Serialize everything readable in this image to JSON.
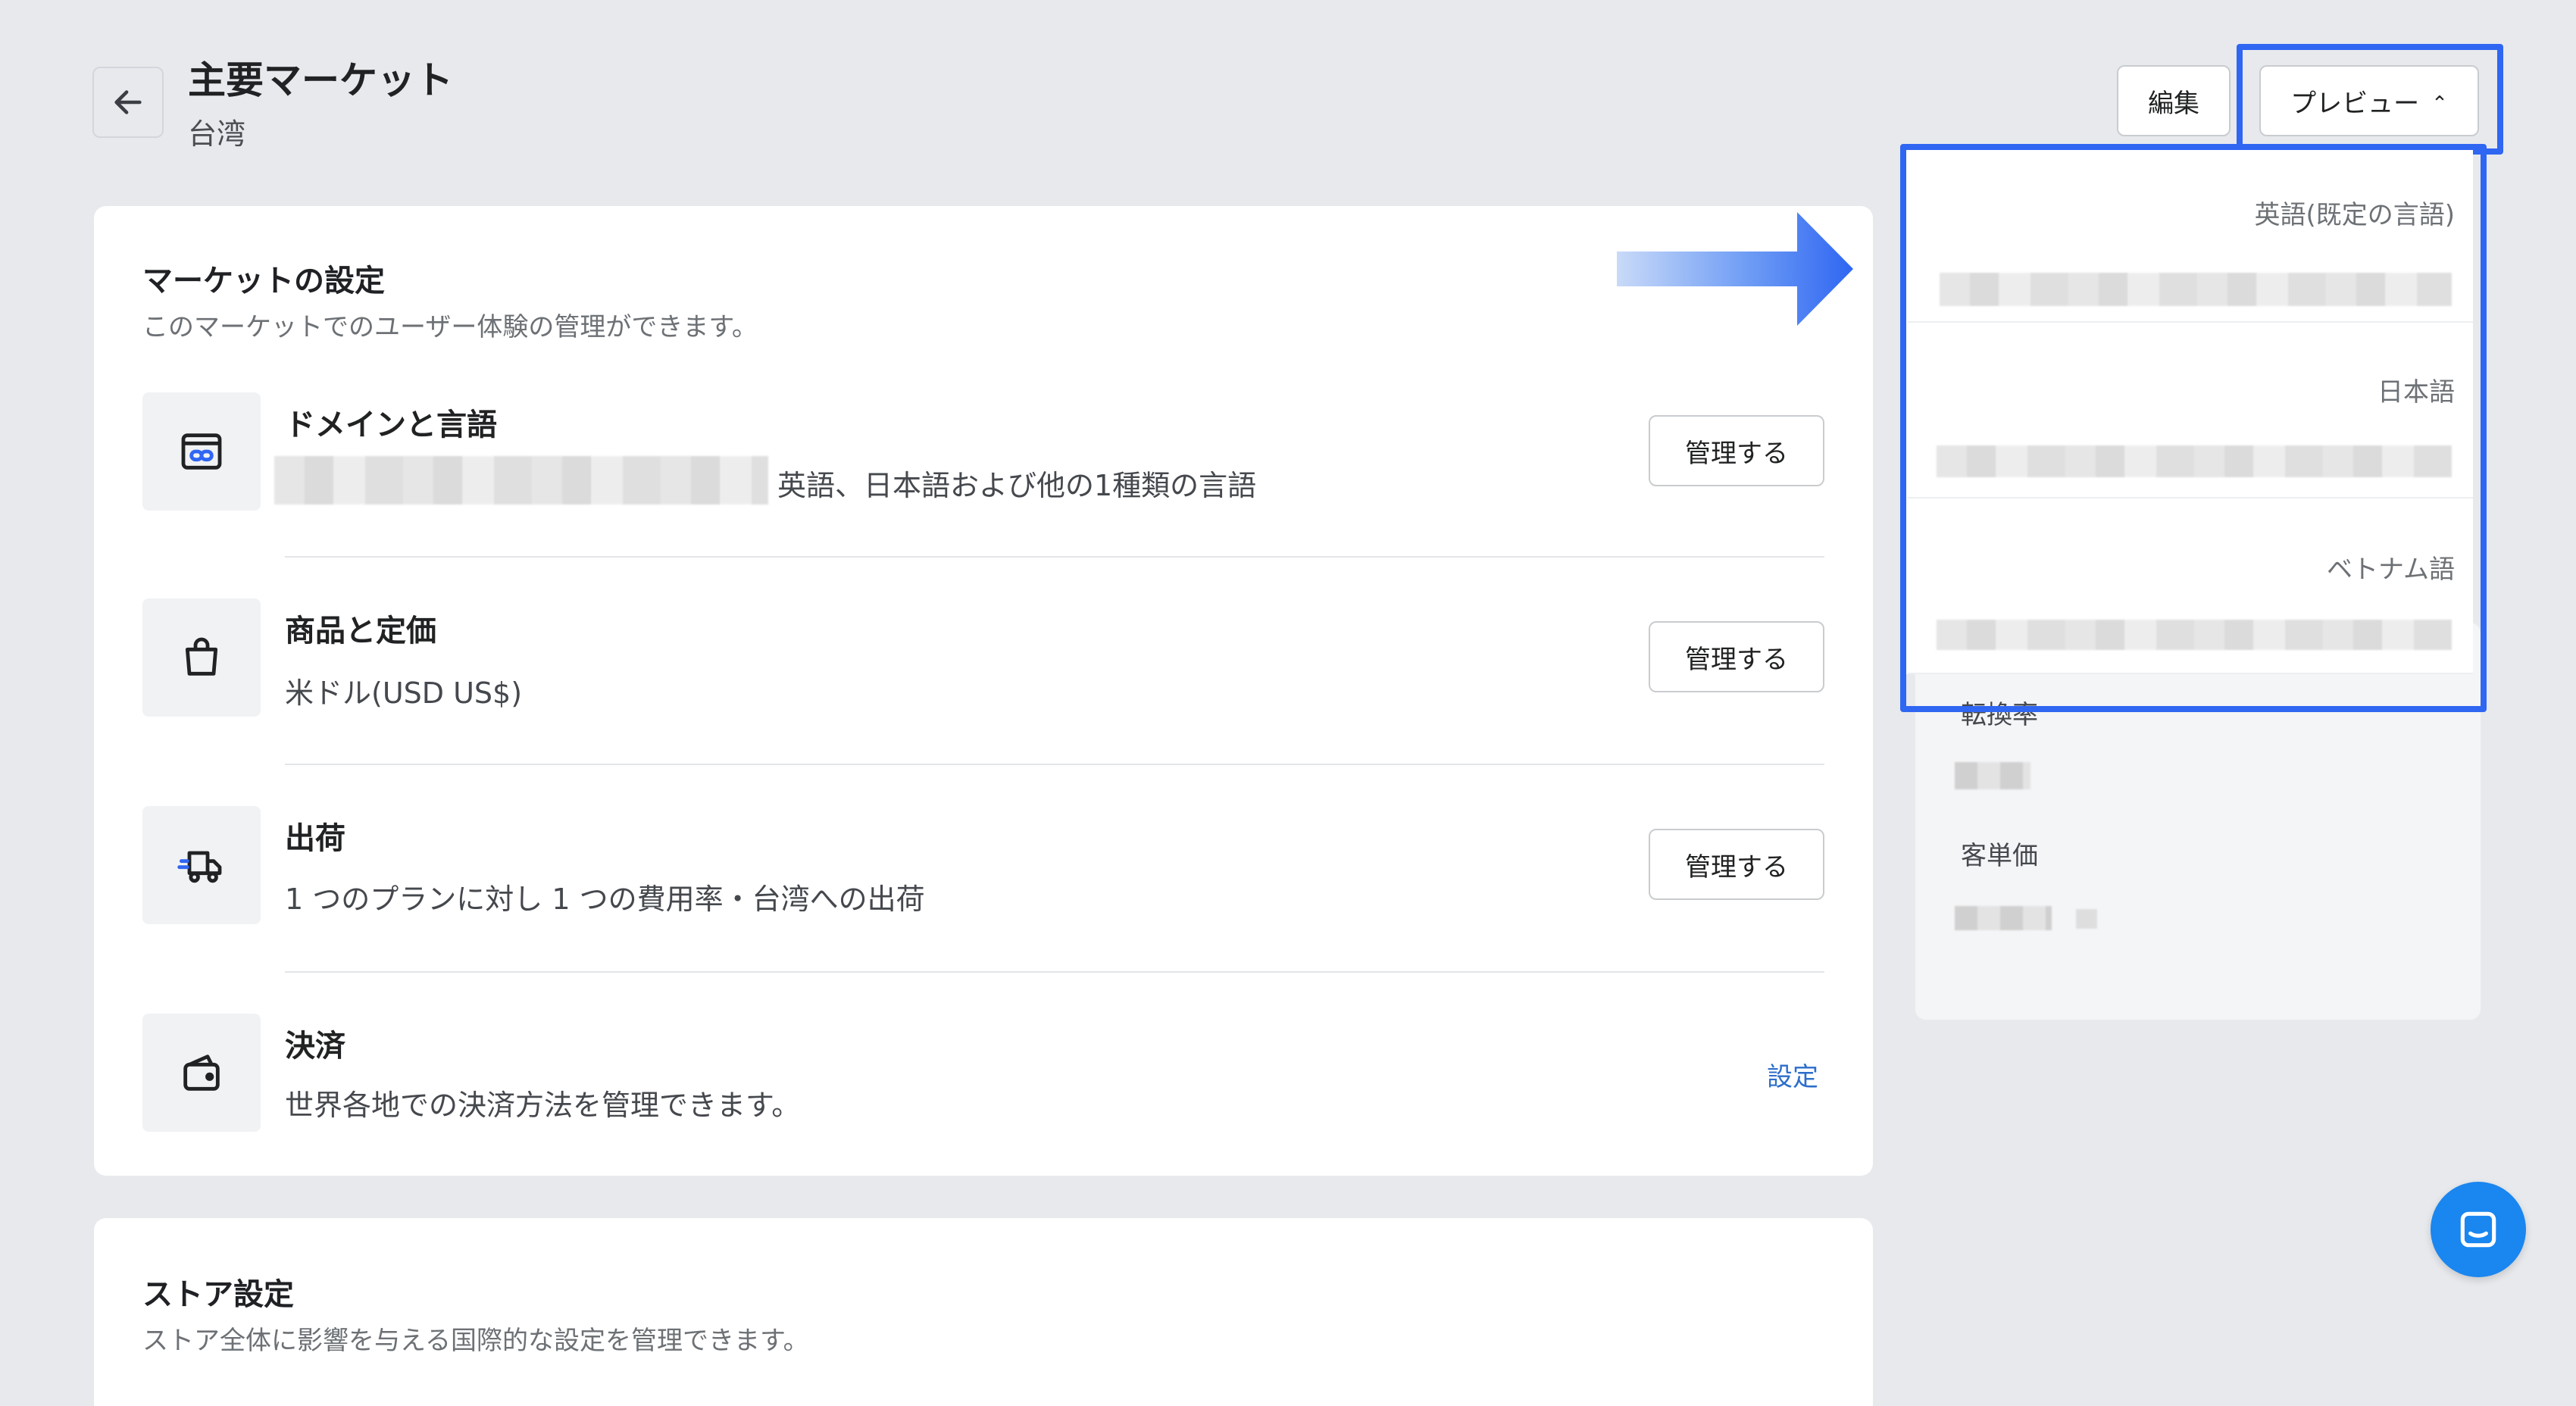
{
  "header": {
    "title": "主要マーケット",
    "subtitle": "台湾",
    "edit_label": "編集",
    "preview_label": "プレビュー",
    "preview_chevron": "⌃"
  },
  "market_settings": {
    "title": "マーケットの設定",
    "description": "このマーケットでのユーザー体験の管理ができます。",
    "rows": [
      {
        "icon": "domain-link-icon",
        "title": "ドメインと言語",
        "description": "英語、日本語および他の1種類の言語",
        "action": "管理する"
      },
      {
        "icon": "shopping-bag-icon",
        "title": "商品と定価",
        "description": "米ドル(USD US$)",
        "action": "管理する"
      },
      {
        "icon": "shipping-truck-icon",
        "title": "出荷",
        "description": "1 つのプランに対し 1 つの費用率・台湾への出荷",
        "action": "管理する"
      },
      {
        "icon": "wallet-icon",
        "title": "決済",
        "description": "世界各地での決済方法を管理できます。",
        "action": "設定"
      }
    ]
  },
  "store_settings": {
    "title": "ストア設定",
    "description": "ストア全体に影響を与える国際的な設定を管理できます。"
  },
  "stats": {
    "conversion_label": "転換率",
    "aov_label": "客単価"
  },
  "preview_dropdown": {
    "items": [
      {
        "label": "英語(既定の言語)"
      },
      {
        "label": "日本語"
      },
      {
        "label": "ベトナム語"
      }
    ]
  },
  "colors": {
    "highlight": "#2f66f2",
    "link": "#2c6ecb",
    "chat": "#1a86f0"
  }
}
